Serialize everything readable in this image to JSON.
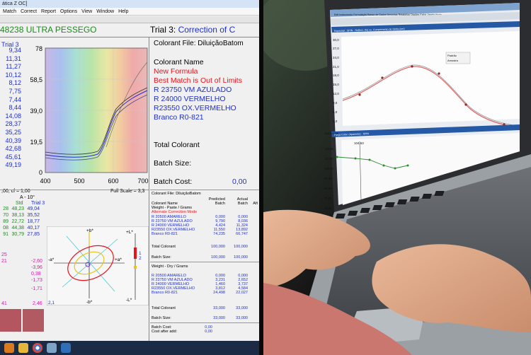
{
  "app": {
    "title": "ática Z OC]",
    "menu": [
      "Match",
      "Correct",
      "Report",
      "Options",
      "View",
      "Window",
      "Help"
    ]
  },
  "batch": {
    "name": "48238 ULTRA PESSEGO",
    "trial_prefix": "Trial 3:",
    "trial_text": " Correction of C"
  },
  "spectral": {
    "y_axis_ticks": [
      "78",
      "58,5",
      "39,0",
      "19,5",
      "0"
    ],
    "x_axis_ticks": [
      "400",
      "500",
      "600",
      "700"
    ],
    "left_label": "Trial 3",
    "left_values": [
      "9,34",
      "11,31",
      "11,27",
      "10,12",
      "8,12",
      "7,75",
      "7,44",
      "8,44",
      "14,08",
      "28,37",
      "35,25",
      "40,39",
      "42,68",
      "45,61",
      "49,19"
    ],
    "footer_left": ",00, cf = 1,00",
    "footer_right": "Full Scale = 3,3"
  },
  "colorant": {
    "file_label": "Colorant File: DiluiçãoBatom",
    "name_label": "Colorant Name",
    "new_formula": "New Formula",
    "best_match": "Best Match is Out of Limits",
    "items": [
      "R 23750 VM AZULADO",
      "R 24000 VERMELHO",
      "R23550 OX.VERMELHO",
      "Branco R0-821"
    ],
    "total": "Total Colorant",
    "batch_size": "Batch Size:",
    "batch_cost": "Batch Cost:",
    "batch_cost_value": "0,00"
  },
  "lab": {
    "header_a": "A - 10°",
    "col_std": "Std",
    "col_trial": "Trial 3",
    "row_l": [
      "28",
      "48,23",
      "49,04"
    ],
    "row_a": [
      "70",
      "38,13",
      "35,52"
    ],
    "row_b": [
      "89",
      "22,72",
      "18,77"
    ],
    "row_c": [
      "08",
      "44,38",
      "40,17"
    ],
    "row_h": [
      "91",
      "30,79",
      "27,85"
    ],
    "deltas_pink": [
      "25",
      "21"
    ],
    "deltas": [
      "-2,60",
      "-3,96",
      "0,38",
      "-1,73",
      "-1,71"
    ],
    "left_deltas": [
      "-2,60"
    ],
    "bottom_left": "41",
    "bottom_right": "2,46",
    "axis_b_plus": "+b*",
    "axis_b_minus": "-b*",
    "axis_a_plus": "+a*",
    "axis_a_minus": "-a*",
    "axis_l_plus": "+L*",
    "axis_l_minus": "-L*",
    "scale_1": "1",
    "scale_2": "2",
    "scale_21": "2,1"
  },
  "formula_table": {
    "file": "Colorant File: DiluiçãoBatom",
    "h_predicted": "Predicted",
    "h_batch": "Batch",
    "h_actual": "Actual",
    "h_after": "Aft",
    "colorant_name": "Colorant Name",
    "weight_wet": "Weight - Paste / Grams",
    "alt_mode": "Alternate Correction Mode",
    "rows_wet": [
      {
        "name": "R 20500 AMARELO",
        "pred": "0,000",
        "act": "0,000"
      },
      {
        "name": "R 23750 VM AZULADO",
        "pred": "9,790",
        "act": "8,036"
      },
      {
        "name": "R 24000 VERMELHO",
        "pred": "4,424",
        "act": "11,324"
      },
      {
        "name": "R23550 OX.VERMELHO",
        "pred": "11,550",
        "act": "13,892"
      },
      {
        "name": "Branco R0-821",
        "pred": "74,235",
        "act": "66,747"
      }
    ],
    "total_wet": {
      "label": "Total Colorant",
      "pred": "100,000",
      "act": "100,000"
    },
    "size_wet": {
      "label": "Batch Size:",
      "pred": "100,000",
      "act": "100,000"
    },
    "weight_dry": "Weight - Dry / Grams",
    "rows_dry": [
      {
        "name": "R 20500 AMARELO",
        "pred": "0,000",
        "act": "0,000"
      },
      {
        "name": "R 23750 VM AZULADO",
        "pred": "3,231",
        "act": "2,652"
      },
      {
        "name": "R 24000 VERMELHO",
        "pred": "1,460",
        "act": "3,737"
      },
      {
        "name": "R23550 OX.VERMELHO",
        "pred": "3,812",
        "act": "4,584"
      },
      {
        "name": "Branco R0-821",
        "pred": "24,498",
        "act": "22,027"
      }
    ],
    "total_dry": {
      "label": "Total Colorant",
      "pred": "33,000",
      "act": "33,000"
    },
    "size_dry": {
      "label": "Batch Size:",
      "pred": "33,000",
      "act": "33,000"
    },
    "cost": {
      "label": "Batch Cost:",
      "val": "0,00"
    },
    "cost_after": {
      "label": "Cost after add:",
      "val": "0,00"
    }
  },
  "laptop": {
    "menu": [
      "Edit",
      "Instrumento",
      "Formulação",
      "Banco de Dados",
      "Amostras",
      "Relatórios",
      "Opções",
      "Exibir",
      "Janela",
      "Ajuda"
    ],
    "window1": "Espectral : SPIN - Reflect. (%) vs. Comprimento de Onda (nm)",
    "legend_padrao": "Padrão",
    "legend_amostra": "Amostra",
    "y_ticks": [
      "30,0",
      "27,0",
      "24,0",
      "21,0",
      "18,0",
      "15,0",
      "12,0",
      "9,0",
      "6,0",
      "3,0"
    ],
    "x_ticks": [
      "500",
      "600"
    ],
    "window2": "Força Color. (Aparente) - SPIN",
    "date": "23/10/2009",
    "readout": "104,63",
    "y2_ticks": [
      "120,00",
      "110,00",
      "100,00",
      "90,00",
      "80,00",
      "70,00",
      "60,00",
      "50,00"
    ]
  }
}
